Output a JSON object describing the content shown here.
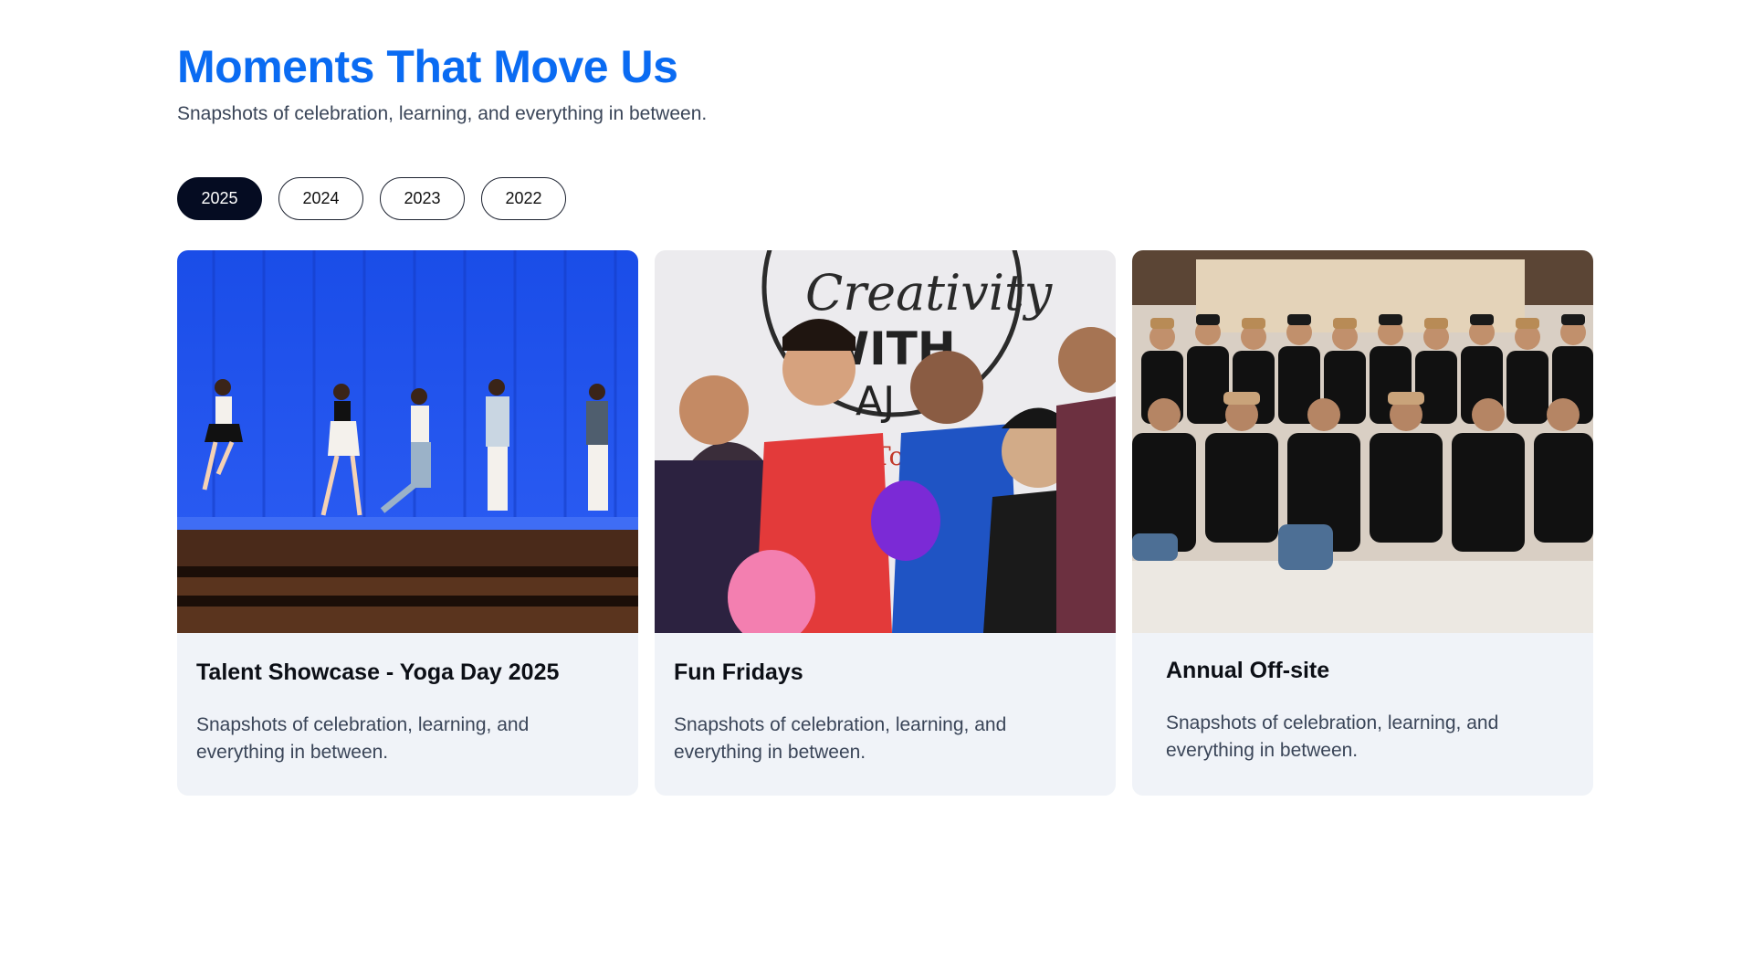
{
  "header": {
    "title": "Moments That Move Us",
    "subtitle": "Snapshots of celebration, learning, and everything in between."
  },
  "tabs": [
    {
      "label": "2025",
      "active": true
    },
    {
      "label": "2024",
      "active": false
    },
    {
      "label": "2023",
      "active": false
    },
    {
      "label": "2022",
      "active": false
    }
  ],
  "cards": [
    {
      "title": "Talent Showcase - Yoga Day 2025",
      "description": "Snapshots of celebration, learning, and everything in between.",
      "image": "photo-dancers-on-stage"
    },
    {
      "title": "Fun Fridays",
      "description": "Snapshots of celebration, learning, and everything in between.",
      "image": "photo-group-selfie-with-balloons",
      "image_text": [
        "Creativity",
        "WITH",
        "AJ",
        "To"
      ]
    },
    {
      "title": "Annual Off-site",
      "description": "Snapshots of celebration, learning, and everything in between.",
      "image": "photo-team-group-in-hats"
    }
  ],
  "colors": {
    "title": "#0a6bf2",
    "active_tab": "#050c22",
    "card_bg": "#f0f3f8",
    "text_muted": "#3a4558"
  }
}
